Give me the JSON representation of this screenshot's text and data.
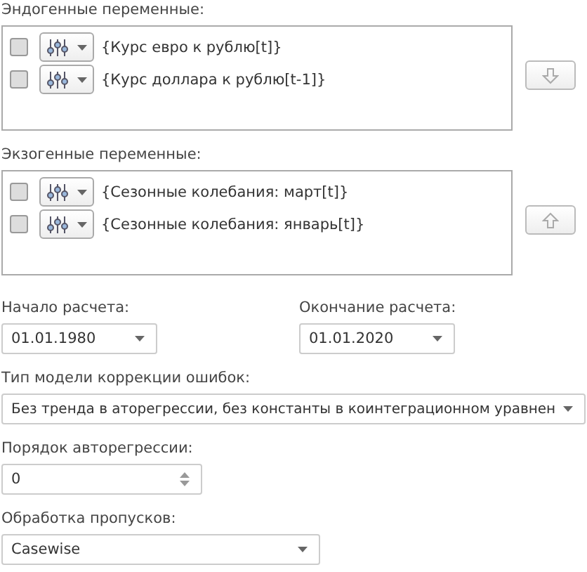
{
  "endogenous": {
    "label": "Эндогенные переменные:",
    "items": [
      {
        "text": "{Курс евро к рублю[t]}",
        "checked": false
      },
      {
        "text": "{Курс доллара к рублю[t-1]}",
        "checked": false
      }
    ]
  },
  "exogenous": {
    "label": "Экзогенные переменные:",
    "items": [
      {
        "text": "{Сезонные колебания: март[t]}",
        "checked": false
      },
      {
        "text": "{Сезонные колебания: январь[t]}",
        "checked": false
      }
    ]
  },
  "start": {
    "label": "Начало расчета:",
    "value": "01.01.1980"
  },
  "end": {
    "label": "Окончание расчета:",
    "value": "01.01.2020"
  },
  "model_type": {
    "label": "Тип модели коррекции ошибок:",
    "value": "Без тренда в аторегрессии, без константы в коинтеграционном уравнен"
  },
  "ar_order": {
    "label": "Порядок авторегрессии:",
    "value": "0"
  },
  "missing": {
    "label": "Обработка пропусков:",
    "value": "Casewise"
  }
}
